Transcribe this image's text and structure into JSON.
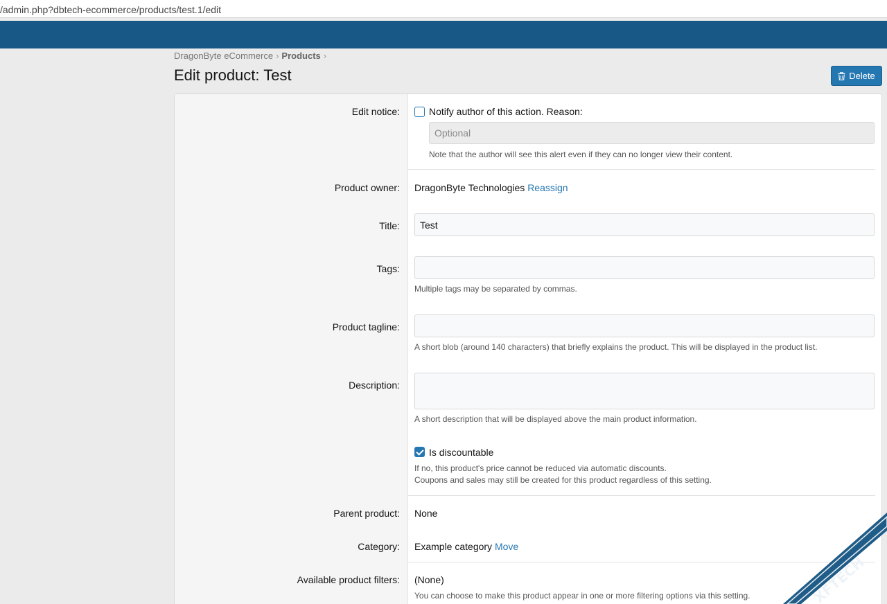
{
  "browser": {
    "url": "/admin.php?dbtech-ecommerce/products/test.1/edit"
  },
  "breadcrumb": {
    "items": [
      "DragonByte eCommerce",
      "Products"
    ]
  },
  "page": {
    "title": "Edit product: Test",
    "delete_label": "Delete"
  },
  "form": {
    "edit_notice": {
      "label": "Edit notice:",
      "checkbox_label": "Notify author of this action. Reason:",
      "checked": false,
      "reason_placeholder": "Optional",
      "hint": "Note that the author will see this alert even if they can no longer view their content."
    },
    "product_owner": {
      "label": "Product owner:",
      "value": "DragonByte Technologies",
      "link": "Reassign"
    },
    "title": {
      "label": "Title:",
      "value": "Test"
    },
    "tags": {
      "label": "Tags:",
      "value": "",
      "hint": "Multiple tags may be separated by commas."
    },
    "tagline": {
      "label": "Product tagline:",
      "value": "",
      "hint": "A short blob (around 140 characters) that briefly explains the product. This will be displayed in the product list."
    },
    "description": {
      "label": "Description:",
      "value": "",
      "hint": "A short description that will be displayed above the main product information."
    },
    "discountable": {
      "label": "Is discountable",
      "checked": true,
      "hint_1": "If no, this product's price cannot be reduced via automatic discounts.",
      "hint_2": "Coupons and sales may still be created for this product regardless of this setting."
    },
    "parent_product": {
      "label": "Parent product:",
      "value": "None"
    },
    "category": {
      "label": "Category:",
      "value": "Example category",
      "link": "Move"
    },
    "filters": {
      "label": "Available product filters:",
      "value": "(None)",
      "hint": "You can choose to make this product appear in one or more filtering options via this setting."
    }
  },
  "watermark": {
    "text": "XFTECH"
  },
  "colors": {
    "accent": "#2577b1",
    "header": "#185886"
  }
}
